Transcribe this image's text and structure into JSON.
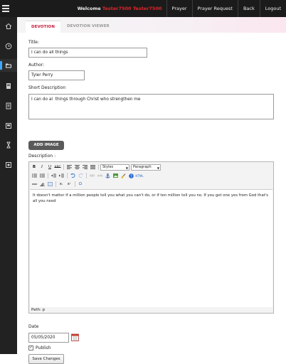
{
  "topbar": {
    "welcome_prefix": "Welcome",
    "username": "Tester7500 Tester7500",
    "nav": [
      "Prayer",
      "Prayer Request",
      "Back",
      "Logout"
    ]
  },
  "sidebar": {
    "items": [
      "home-icon",
      "clock-icon",
      "folder-icon",
      "book-icon",
      "document-icon",
      "monitor-icon",
      "hourglass-icon",
      "image-icon"
    ],
    "active_index": 2,
    "accent": "#3fa7ff"
  },
  "tabs": [
    {
      "label": "DEVOTION",
      "active": true
    },
    {
      "label": "DEVOTION VIEWER",
      "active": false
    }
  ],
  "form": {
    "title_label": "Title:",
    "title_value": "I can do all things",
    "author_label": "Author:",
    "author_value": "Tyler Perry",
    "short_desc_label": "Short Description",
    "short_desc_value": "I can do al  things through Christ who strengthen me",
    "add_image_label": "ADD IMAGE",
    "description_label": "Description :",
    "editor": {
      "styles_select": "Styles",
      "format_select": "Paragraph",
      "content": "It doesn't matter if a million people tell you what you can't do, or if ten million tell you no. If you get one yes from God that's all you need",
      "path": "Path: p"
    },
    "date_label": "Date",
    "date_value": "05/05/2020",
    "publish_label": "Publish",
    "publish_checked": true,
    "save_label": "Save Changes"
  },
  "colors": {
    "brand_red": "#c7183a",
    "username_red": "#e0262b",
    "topbar_bg": "#1b1b1b"
  }
}
